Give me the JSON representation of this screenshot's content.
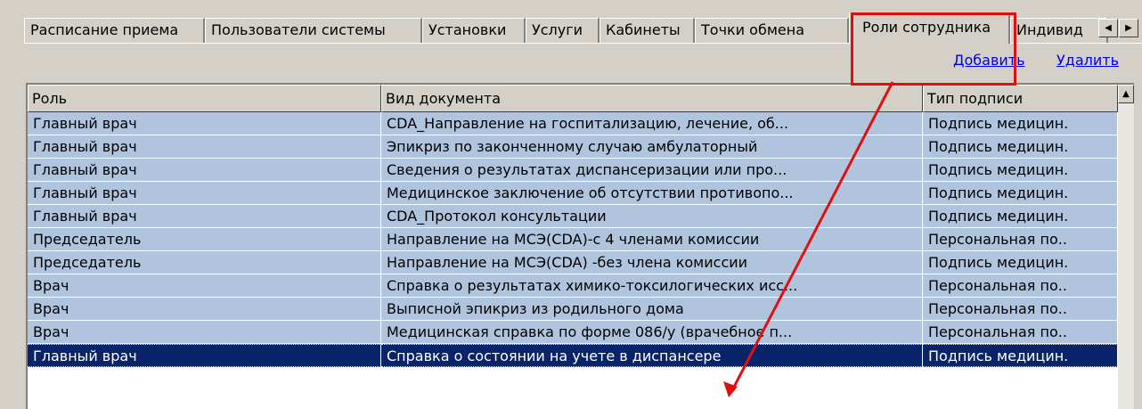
{
  "tabs": [
    {
      "label": "Расписание приема",
      "active": false
    },
    {
      "label": "Пользователи системы",
      "active": false
    },
    {
      "label": "Установки",
      "active": false
    },
    {
      "label": "Услуги",
      "active": false
    },
    {
      "label": "Кабинеты",
      "active": false
    },
    {
      "label": "Точки обмена",
      "active": false
    },
    {
      "label": "Роли сотрудника",
      "active": true
    },
    {
      "label": "Индивид",
      "active": false
    }
  ],
  "tab_scroll": {
    "left_icon": "◀",
    "right_icon": "▶"
  },
  "actions": {
    "add_label": "Добавить",
    "delete_label": "Удалить"
  },
  "table": {
    "columns": [
      "Роль",
      "Вид документа",
      "Тип подписи"
    ],
    "scroll_up_icon": "▲",
    "rows": [
      {
        "role": "Главный врач",
        "doc": "CDA_Направление на госпитализацию, лечение, об...",
        "sign": "Подпись медицин."
      },
      {
        "role": "Главный врач",
        "doc": "Эпикриз по законченному случаю амбулаторный",
        "sign": "Подпись медицин."
      },
      {
        "role": "Главный врач",
        "doc": "Сведения о результатах диспансеризации или про...",
        "sign": "Подпись медицин."
      },
      {
        "role": "Главный врач",
        "doc": "Медицинское заключение об отсутствии противопо...",
        "sign": "Подпись медицин."
      },
      {
        "role": "Главный врач",
        "doc": "CDA_Протокол консультации",
        "sign": "Подпись медицин."
      },
      {
        "role": "Председатель",
        "doc": "Направление на МСЭ(CDA)-с 4 членами комиссии",
        "sign": "Персональная по.."
      },
      {
        "role": "Председатель",
        "doc": "Направление на МСЭ(CDA) -без члена комиссии",
        "sign": "Подпись медицин."
      },
      {
        "role": "Врач",
        "doc": "Справка о результатах химико-токсилогических исс...",
        "sign": "Персональная по.."
      },
      {
        "role": "Врач",
        "doc": "Выписной эпикриз из родильного дома",
        "sign": "Персональная по.."
      },
      {
        "role": "Врач",
        "doc": "Медицинская справка по форме 086/у (врачебное п...",
        "sign": "Персональная по.."
      },
      {
        "role": "Главный врач",
        "doc": "Справка о состоянии на учете в диспансере",
        "sign": "Подпись медицин.",
        "selected": true
      }
    ]
  },
  "colors": {
    "row_bg": "#b0c4de",
    "selected_bg": "#0a246a",
    "annotation": "#e01010",
    "link": "#0000ee"
  }
}
